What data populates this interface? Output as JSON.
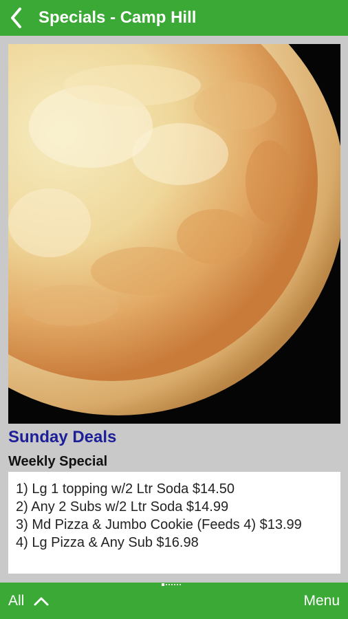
{
  "app_bar": {
    "title": "Specials - Camp Hill",
    "back_icon": "chevron-left-icon",
    "color": "#3ba935"
  },
  "hero_image": {
    "subject": "cheese pizza on black background"
  },
  "deal": {
    "title": "Sunday Deals",
    "subtitle": "Weekly Special",
    "title_color": "#1d1f99",
    "items": [
      "1) Lg 1 topping w/2 Ltr Soda $14.50",
      "2) Any 2 Subs w/2 Ltr Soda $14.99",
      "3) Md Pizza & Jumbo Cookie (Feeds 4) $13.99",
      "4) Lg Pizza & Any Sub $16.98"
    ]
  },
  "bottom_bar": {
    "all_label": "All",
    "all_icon": "chevron-up-icon",
    "menu_label": "Menu",
    "page_count": 7,
    "active_page": 1
  }
}
